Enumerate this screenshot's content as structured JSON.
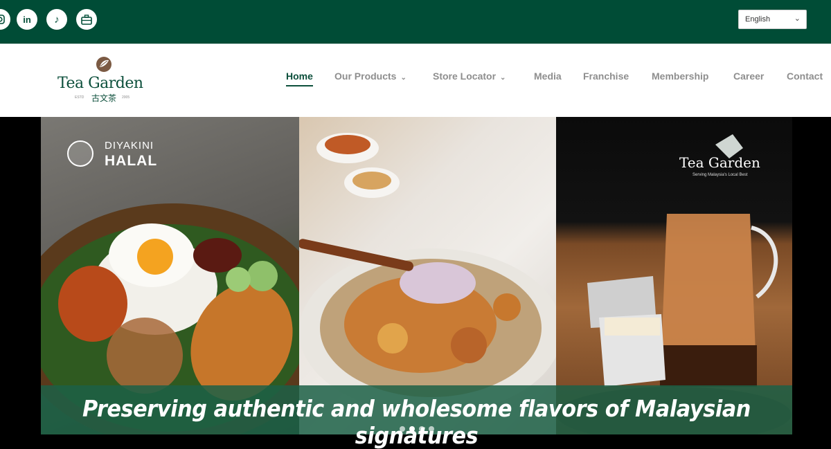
{
  "topbar": {
    "social": [
      {
        "name": "instagram-icon"
      },
      {
        "name": "linkedin-icon",
        "glyph": "in"
      },
      {
        "name": "tiktok-icon",
        "glyph": "♪"
      },
      {
        "name": "jobs-briefcase-icon"
      }
    ],
    "language": {
      "selected": "English"
    }
  },
  "header": {
    "logo": {
      "text": "Tea Garden",
      "chinese": "古文茶",
      "estd": "ESTD",
      "year": "2005"
    },
    "nav": [
      {
        "label": "Home",
        "active": true
      },
      {
        "label": "Our Products",
        "dropdown": true
      },
      {
        "label": "Store Locator",
        "dropdown": true
      },
      {
        "label": "Media"
      },
      {
        "label": "Franchise"
      },
      {
        "label": "Membership"
      },
      {
        "label": "Career"
      },
      {
        "label": "Contact"
      }
    ]
  },
  "hero": {
    "halal_line1": "DIYAKINI",
    "halal_line2": "HALAL",
    "panel3_logo": "Tea Garden",
    "panel3_tagline": "Serving Malaysia's Local Best",
    "caption": "Preserving authentic and wholesome flavors of Malaysian signatures",
    "slides": 4,
    "active_slide": 2
  },
  "colors": {
    "brand": "#004c36",
    "text_muted": "#8e8e8e",
    "caption_band": "#1c6046"
  }
}
